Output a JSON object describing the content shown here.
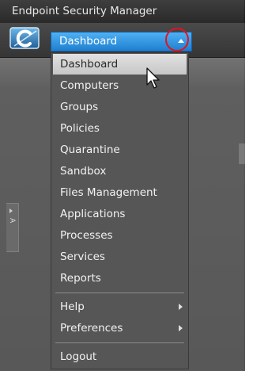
{
  "window": {
    "title": "Endpoint Security Manager"
  },
  "toolbar": {
    "logo_icon": "comodo-c-logo-icon",
    "module_select": {
      "value": "Dashboard",
      "icon": "caret-up-icon"
    }
  },
  "side_panel": {
    "tab_label": "A"
  },
  "menu": {
    "items": [
      {
        "label": "Dashboard",
        "selected": true
      },
      {
        "label": "Computers"
      },
      {
        "label": "Groups"
      },
      {
        "label": "Policies"
      },
      {
        "label": "Quarantine"
      },
      {
        "label": "Sandbox"
      },
      {
        "label": "Files Management"
      },
      {
        "label": "Applications"
      },
      {
        "label": "Processes"
      },
      {
        "label": "Services"
      },
      {
        "label": "Reports"
      }
    ],
    "submenus": [
      {
        "label": "Help",
        "icon": "chevron-right-icon"
      },
      {
        "label": "Preferences",
        "icon": "chevron-right-icon"
      }
    ],
    "logout": {
      "label": "Logout"
    }
  },
  "colors": {
    "accent_blue": "#1e7fd0",
    "highlight_red": "#e4131b",
    "menu_bg": "#565656"
  }
}
